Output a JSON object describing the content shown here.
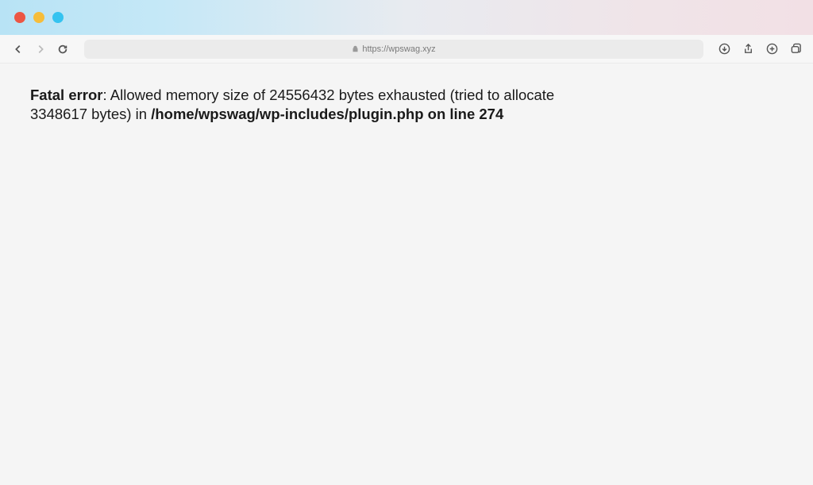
{
  "browser": {
    "url": "https://wpswag.xyz"
  },
  "error": {
    "label": "Fatal error",
    "message_part1": ": Allowed memory size of 24556432 bytes exhausted (tried to allocate 3348617 bytes) in ",
    "file_info": "/home/wpswag/wp-includes/plugin.php on line 274"
  }
}
